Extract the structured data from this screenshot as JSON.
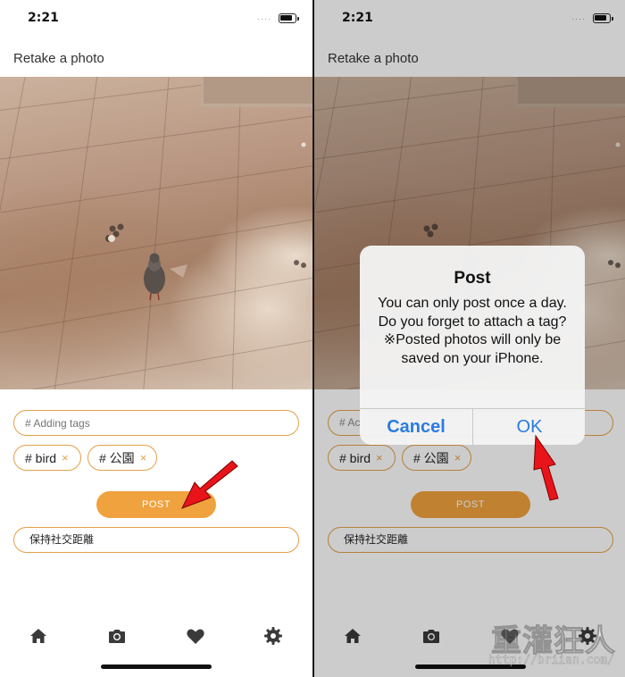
{
  "status": {
    "time": "2:21",
    "signal_dots": "····"
  },
  "header": {
    "title": "Retake a photo"
  },
  "photo": {
    "subject": "pigeon on tiled pavement"
  },
  "tags": {
    "placeholder": "# Adding tags",
    "items": [
      {
        "label": "# bird",
        "remove": "×"
      },
      {
        "label": "# 公園",
        "remove": "×"
      }
    ]
  },
  "post_button": {
    "label": "POST"
  },
  "message": {
    "value": "保持社交距離"
  },
  "tabbar": {
    "items": [
      {
        "icon": "home-icon"
      },
      {
        "icon": "camera-icon"
      },
      {
        "icon": "heart-icon"
      },
      {
        "icon": "gear-icon"
      }
    ]
  },
  "alert": {
    "title": "Post",
    "message": "You can only post once a day. Do you forget to attach a tag?※Posted photos will only be saved on your iPhone.",
    "cancel_label": "Cancel",
    "ok_label": "OK"
  },
  "right_screen": {
    "tag_placeholder_partial": "# Ac"
  },
  "watermark": {
    "text": "重灌狂人",
    "url": "http://briian.com/"
  },
  "colors": {
    "accent": "#f0a23e",
    "accent_border": "#e3a04a",
    "ios_blue": "#2b7ce0",
    "annotation_arrow": "#e8141a"
  }
}
